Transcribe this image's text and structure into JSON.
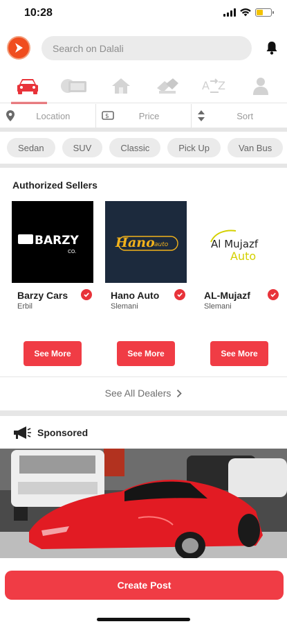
{
  "status_bar": {
    "time": "10:28"
  },
  "header": {
    "search_placeholder": "Search on Dalali",
    "bell_icon": "bell-icon"
  },
  "category_tabs": [
    {
      "name": "car",
      "icon": "car-icon",
      "active": true
    },
    {
      "name": "plate",
      "icon": "plate-icon",
      "active": false
    },
    {
      "name": "property",
      "icon": "house-icon",
      "active": false
    },
    {
      "name": "parts",
      "icon": "parts-icon",
      "active": false
    },
    {
      "name": "a-to-z",
      "icon": "a-to-z-icon",
      "active": false
    },
    {
      "name": "person",
      "icon": "person-icon",
      "active": false
    }
  ],
  "filters": {
    "location": "Location",
    "price": "Price",
    "sort": "Sort"
  },
  "body_types": [
    "Sedan",
    "SUV",
    "Classic",
    "Pick Up",
    "Van Bus"
  ],
  "authorized_sellers": {
    "title": "Authorized Sellers",
    "sellers": [
      {
        "name": "Barzy Cars",
        "city": "Erbil",
        "logo_text": "BARZY",
        "logo_subtext": "CO.",
        "button": "See More"
      },
      {
        "name": "Hano Auto",
        "city": "Slemani",
        "logo_text": "Hano",
        "logo_subtext": "auto",
        "button": "See More"
      },
      {
        "name": "AL-Mujazf",
        "city": "Slemani",
        "logo_text": "Al Mujazf",
        "logo_subtext": "Auto",
        "button": "See More"
      }
    ],
    "see_all": "See All Dealers"
  },
  "sponsored": {
    "title": "Sponsored"
  },
  "create_post": "Create Post",
  "colors": {
    "accent": "#f03c45",
    "logo_orange": "#f04d1e",
    "chip_bg": "#ebebeb",
    "hano_logo": "#f2b21b",
    "mujazf_logo": "#d4d000"
  }
}
